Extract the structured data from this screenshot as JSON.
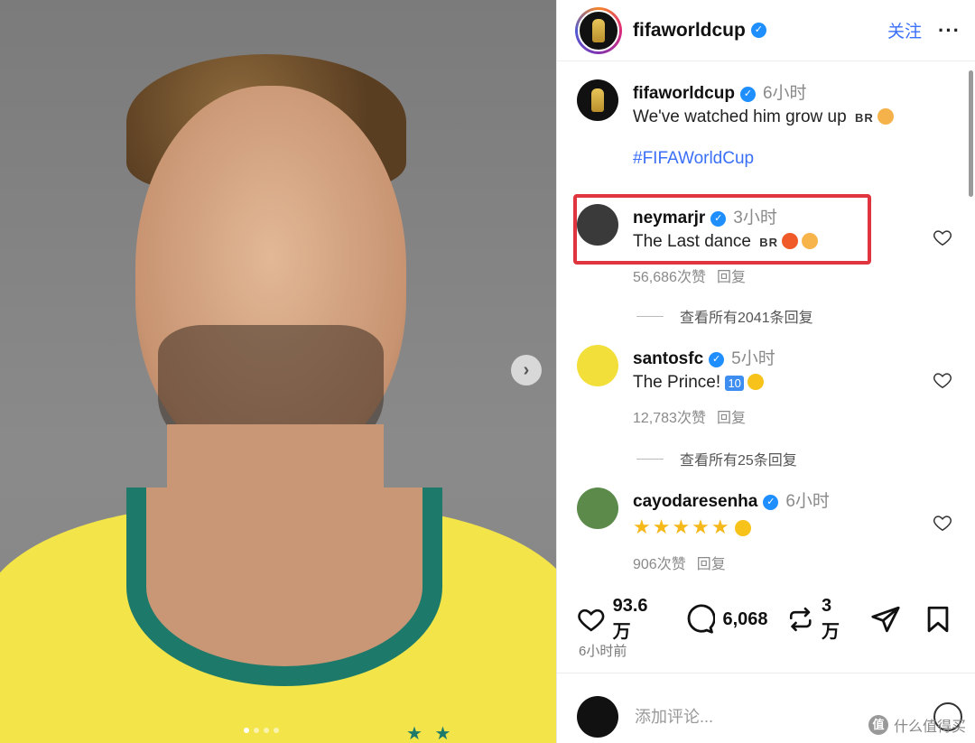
{
  "post": {
    "account": "fifaworldcup",
    "follow_label": "关注",
    "more_icon": "ellipsis-icon",
    "caption_author": "fifaworldcup",
    "caption_time": "6小时",
    "caption_text": "We've watched him grow up",
    "caption_flag": "BR",
    "hashtag": "#FIFAWorldCup"
  },
  "comments": [
    {
      "user": "neymarjr",
      "time": "3小时",
      "text": "The Last dance",
      "flag": "BR",
      "likes": "56,686次赞",
      "reply": "回复",
      "view_replies": "查看所有2041条回复"
    },
    {
      "user": "santosfc",
      "time": "5小时",
      "text": "The Prince!",
      "badge": "10",
      "likes": "12,783次赞",
      "reply": "回复",
      "view_replies": "查看所有25条回复"
    },
    {
      "user": "cayodaresenha",
      "time": "6小时",
      "stars": "★★★★★",
      "likes": "906次赞",
      "reply": "回复"
    }
  ],
  "actions": {
    "likes": "93.6 万",
    "comments": "6,068",
    "reposts": "3 万"
  },
  "posted_ago": "6小时前",
  "comment_box": {
    "placeholder": "添加评论..."
  },
  "watermark": "什么值得买",
  "watermark_logo": "值",
  "colors": {
    "link": "#3a6ff7",
    "verified": "#1f8fff",
    "highlight": "#e0343e",
    "shirt": "#f3e44a",
    "collar": "#1d7a6a"
  }
}
